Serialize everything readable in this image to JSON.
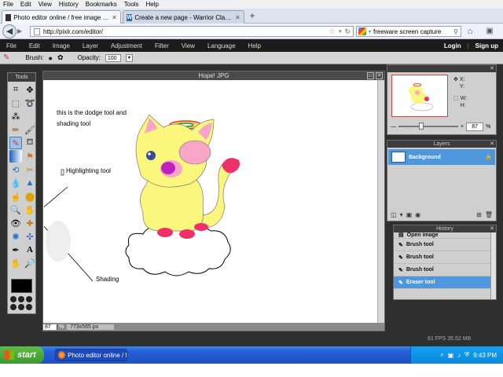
{
  "browser": {
    "menu": [
      "File",
      "Edit",
      "View",
      "History",
      "Bookmarks",
      "Tools",
      "Help"
    ],
    "tabs": [
      {
        "label": "Photo editor online / free image editing di...",
        "active": true
      },
      {
        "label": "Create a new page - Warrior Clan Fanfict...",
        "active": false
      }
    ],
    "url": "http://pixlr.com/editor/",
    "search_value": "freeware screen capture"
  },
  "pixlr": {
    "menu": [
      "File",
      "Edit",
      "Image",
      "Layer",
      "Adjustment",
      "Filter",
      "View",
      "Language",
      "Help"
    ],
    "login": "Login",
    "signup": "Sign up",
    "options": {
      "brush_label": "Brush:",
      "opacity_label": "Opacity:",
      "opacity_value": "100"
    },
    "tools_title": "Tools",
    "document": {
      "title": "Hope! JPG",
      "zoom": "87",
      "zoom_unit": "%",
      "size": "773x565 px",
      "notes": [
        {
          "text": "this is the dodge tool and"
        },
        {
          "text": "shading tool"
        },
        {
          "text": "Highlighting tool"
        },
        {
          "text": "Shading"
        }
      ]
    },
    "navigator": {
      "x_label": "X:",
      "y_label": "Y:",
      "w_label": "W:",
      "h_label": "H:",
      "zoom_value": "87"
    },
    "layers": {
      "title": "Layers",
      "items": [
        {
          "name": "Background"
        }
      ]
    },
    "history": {
      "title": "History",
      "items": [
        {
          "label": "Open image",
          "active": false
        },
        {
          "label": "Brush tool",
          "active": false
        },
        {
          "label": "Brush tool",
          "active": false
        },
        {
          "label": "Brush tool",
          "active": false
        },
        {
          "label": "Eraser tool",
          "active": true
        }
      ]
    },
    "stats": "61 FPS 35.52 MB"
  },
  "taskbar": {
    "start": "start",
    "item": "Photo editor online / f...",
    "clock": "9:43 PM"
  },
  "colors": {
    "pixlr_dark": "#1c1c1c",
    "panel": "#cfcfcf",
    "selection": "#4e97dd",
    "xp_blue": "#245ed6"
  }
}
